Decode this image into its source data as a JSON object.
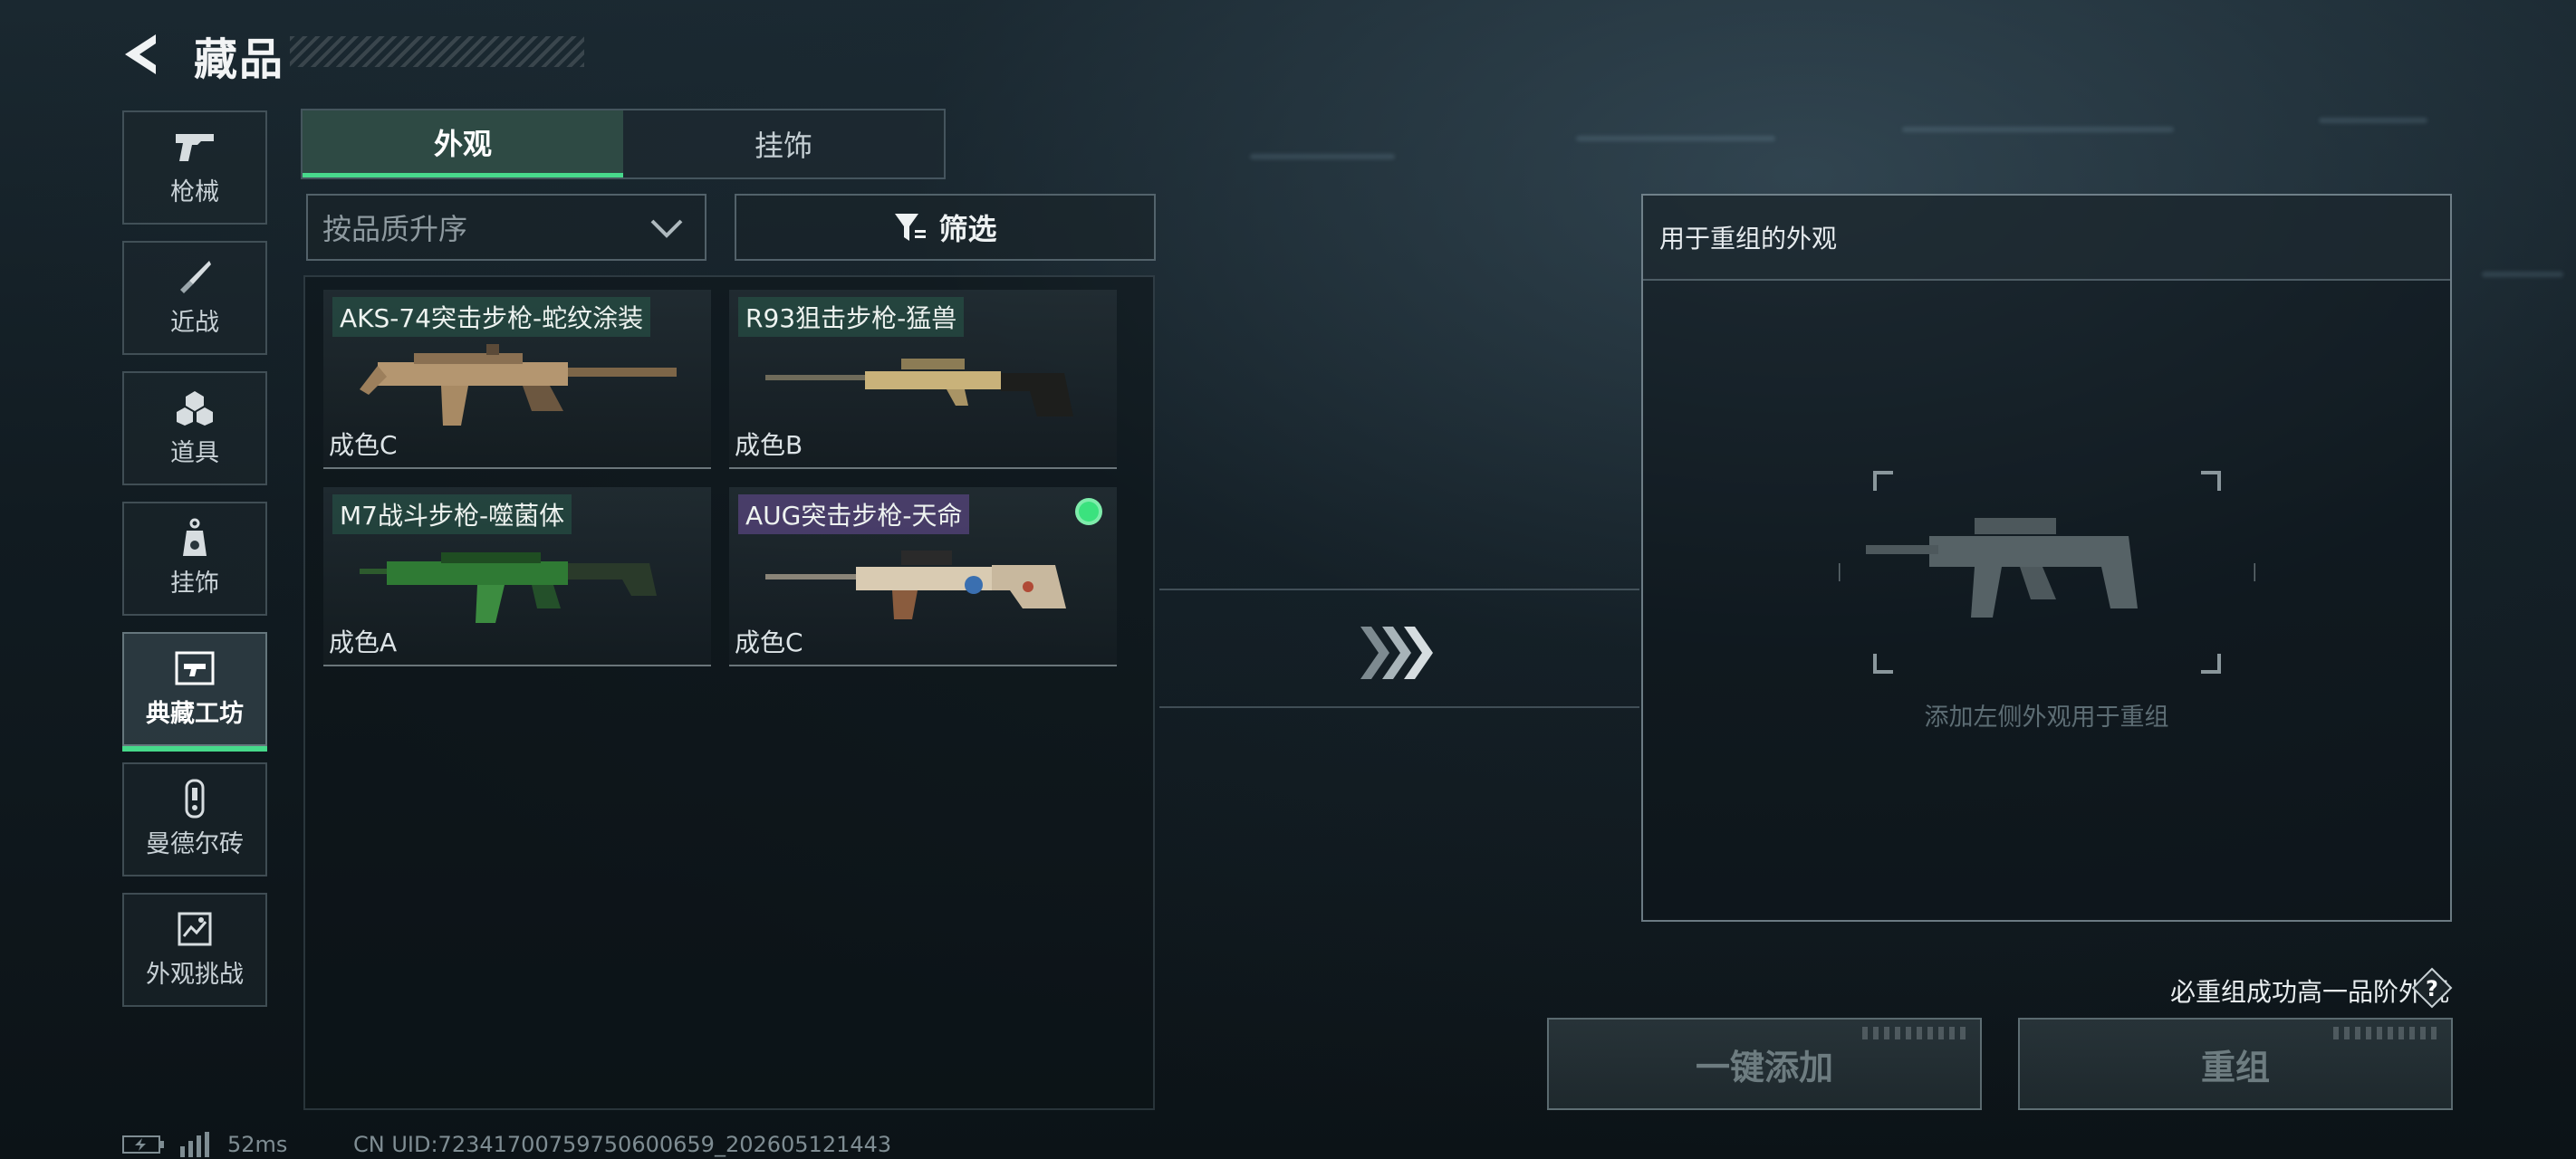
{
  "header": {
    "title": "藏品"
  },
  "sidebar": {
    "items": [
      {
        "label": "枪械",
        "icon": "pistol-icon"
      },
      {
        "label": "近战",
        "icon": "knife-icon"
      },
      {
        "label": "道具",
        "icon": "grenade-icon"
      },
      {
        "label": "挂饰",
        "icon": "charm-icon"
      },
      {
        "label": "典藏工坊",
        "icon": "workshop-icon",
        "active": true
      },
      {
        "label": "曼德尔砖",
        "icon": "brick-icon"
      },
      {
        "label": "外观挑战",
        "icon": "challenge-icon"
      }
    ]
  },
  "tabs": [
    {
      "label": "外观",
      "active": true
    },
    {
      "label": "挂饰",
      "active": false
    }
  ],
  "sort": {
    "value": "按品质升序"
  },
  "filter": {
    "label": "筛选"
  },
  "items": [
    {
      "name": "AKS-74突击步枪-蛇纹涂装",
      "grade": "成色C"
    },
    {
      "name": "R93狙击步枪-猛兽",
      "grade": "成色B"
    },
    {
      "name": "M7战斗步枪-噬菌体",
      "grade": "成色A"
    },
    {
      "name": "AUG突击步枪-天命",
      "grade": "成色C",
      "selected": true
    }
  ],
  "panel": {
    "title": "用于重组的外观",
    "hint": "添加左侧外观用于重组"
  },
  "note": "必重组成功高一品阶外观",
  "buttons": {
    "add_all": "一键添加",
    "recombine": "重组"
  },
  "status": {
    "ping": "52ms",
    "uid": "CN UID:72341700759750600659_202605121443"
  },
  "colors": {
    "accent": "#46d98a",
    "selected_dot": "#3be27e"
  }
}
